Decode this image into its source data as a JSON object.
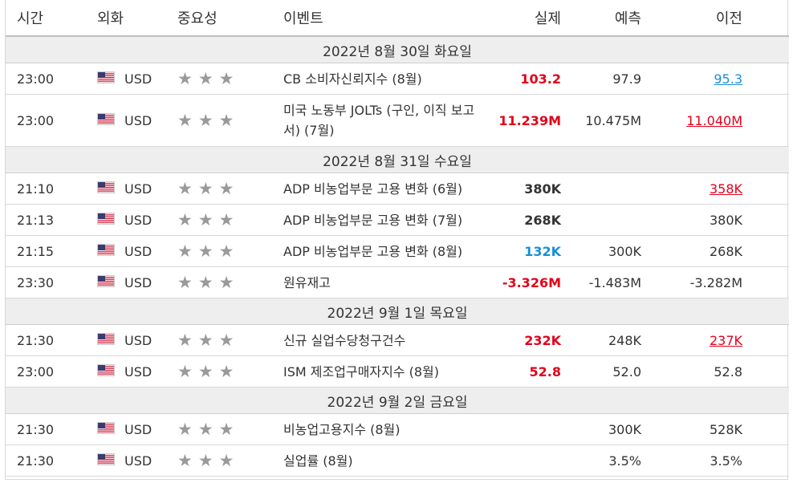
{
  "headers": {
    "time": "시간",
    "currency": "외화",
    "importance": "중요성",
    "event": "이벤트",
    "actual": "실제",
    "forecast": "예측",
    "previous": "이전"
  },
  "colors": {
    "up": "#e2001a",
    "down": "#1a8fd8",
    "star": "#9a9a9a",
    "day_bg": "#eeeeee"
  },
  "groups": [
    {
      "date": "2022년 8월 30일 화요일",
      "events": [
        {
          "time": "23:00",
          "currency": "USD",
          "stars": 3,
          "event": "CB 소비자신뢰지수 (8월)",
          "actual": "103.2",
          "actual_style": "red",
          "forecast": "97.9",
          "previous": "95.3",
          "previous_style": "blue-u"
        },
        {
          "time": "23:00",
          "currency": "USD",
          "stars": 3,
          "event": "미국 노동부 JOLTs (구인, 이직 보고서) (7월)",
          "actual": "11.239M",
          "actual_style": "red",
          "forecast": "10.475M",
          "previous": "11.040M",
          "previous_style": "red-u",
          "tall": true
        }
      ]
    },
    {
      "date": "2022년 8월 31일 수요일",
      "events": [
        {
          "time": "21:10",
          "currency": "USD",
          "stars": 3,
          "event": "ADP 비농업부문 고용 변화 (6월)",
          "actual": "380K",
          "actual_style": "",
          "forecast": "",
          "previous": "358K",
          "previous_style": "red-u"
        },
        {
          "time": "21:13",
          "currency": "USD",
          "stars": 3,
          "event": "ADP 비농업부문 고용 변화 (7월)",
          "actual": "268K",
          "actual_style": "",
          "forecast": "",
          "previous": "380K",
          "previous_style": ""
        },
        {
          "time": "21:15",
          "currency": "USD",
          "stars": 3,
          "event": "ADP 비농업부문 고용 변화 (8월)",
          "actual": "132K",
          "actual_style": "blue",
          "forecast": "300K",
          "previous": "268K",
          "previous_style": ""
        },
        {
          "time": "23:30",
          "currency": "USD",
          "stars": 3,
          "event": "원유재고",
          "actual": "-3.326M",
          "actual_style": "red",
          "forecast": "-1.483M",
          "previous": "-3.282M",
          "previous_style": ""
        }
      ]
    },
    {
      "date": "2022년 9월 1일 목요일",
      "events": [
        {
          "time": "21:30",
          "currency": "USD",
          "stars": 3,
          "event": "신규 실업수당청구건수",
          "actual": "232K",
          "actual_style": "red",
          "forecast": "248K",
          "previous": "237K",
          "previous_style": "red-u"
        },
        {
          "time": "23:00",
          "currency": "USD",
          "stars": 3,
          "event": "ISM 제조업구매자지수 (8월)",
          "actual": "52.8",
          "actual_style": "red",
          "forecast": "52.0",
          "previous": "52.8",
          "previous_style": ""
        }
      ]
    },
    {
      "date": "2022년 9월 2일 금요일",
      "events": [
        {
          "time": "21:30",
          "currency": "USD",
          "stars": 3,
          "event": "비농업고용지수 (8월)",
          "actual": "",
          "actual_style": "",
          "forecast": "300K",
          "previous": "528K",
          "previous_style": ""
        },
        {
          "time": "21:30",
          "currency": "USD",
          "stars": 3,
          "event": "실업률 (8월)",
          "actual": "",
          "actual_style": "",
          "forecast": "3.5%",
          "previous": "3.5%",
          "previous_style": ""
        }
      ]
    }
  ]
}
